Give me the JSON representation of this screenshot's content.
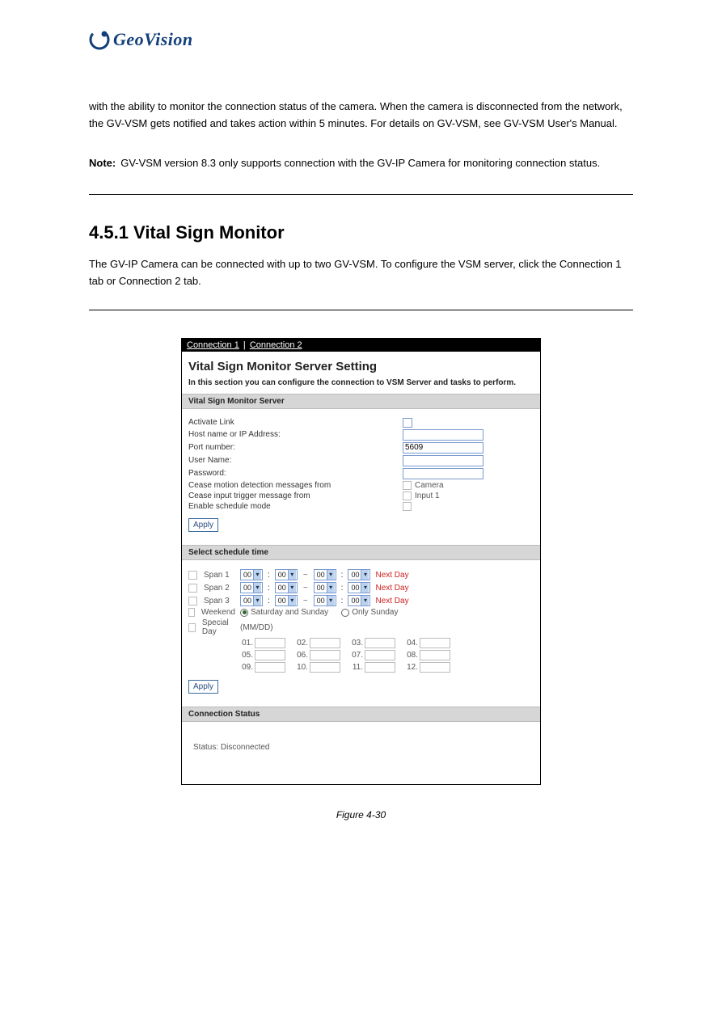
{
  "logo": {
    "text": "GeoVision"
  },
  "intro_paragraph": "with the ability to monitor the connection status of the camera. When the camera is disconnected from the network, the GV-VSM gets notified and takes action within 5 minutes. For details on GV-VSM, see GV-VSM User's Manual.",
  "note": {
    "label": "Note:",
    "text": "GV-VSM version 8.3 only supports connection with the GV-IP Camera for monitoring connection status."
  },
  "section": {
    "title": "4.5.1 Vital Sign Monitor",
    "body": "The GV-IP Camera can be connected with up to two GV-VSM. To configure the VSM server, click the Connection 1 tab or Connection 2 tab."
  },
  "screenshot": {
    "tabs": {
      "c1": "Connection 1",
      "c2": "Connection 2",
      "sep": "|"
    },
    "title": "Vital Sign Monitor Server Setting",
    "subtitle": "In this section you can configure the connection to VSM Server and tasks to perform.",
    "band1": "Vital Sign Monitor Server",
    "fields": {
      "activate": "Activate Link",
      "host": "Host name or IP Address:",
      "port": "Port number:",
      "port_value": "5609",
      "user": "User Name:",
      "pass": "Password:",
      "cease_motion": "Cease motion detection messages from",
      "camera": "Camera",
      "cease_input": "Cease input trigger message from",
      "input1": "Input 1",
      "enable_sched": "Enable schedule mode"
    },
    "apply": "Apply",
    "band2": "Select schedule time",
    "schedule": {
      "span1": "Span 1",
      "span2": "Span 2",
      "span3": "Span 3",
      "weekend": "Weekend",
      "special": "Special Day",
      "sel_val": "00",
      "nextday": "Next Day",
      "sat_sun": "Saturday and Sunday",
      "only_sun": "Only Sunday",
      "mmdd": "(MM/DD)",
      "days": [
        "01.",
        "02.",
        "03.",
        "04.",
        "05.",
        "06.",
        "07.",
        "08.",
        "09.",
        "10.",
        "11.",
        "12."
      ]
    },
    "band3": "Connection Status",
    "status_text": "Status: Disconnected"
  },
  "caption": "Figure 4-30"
}
